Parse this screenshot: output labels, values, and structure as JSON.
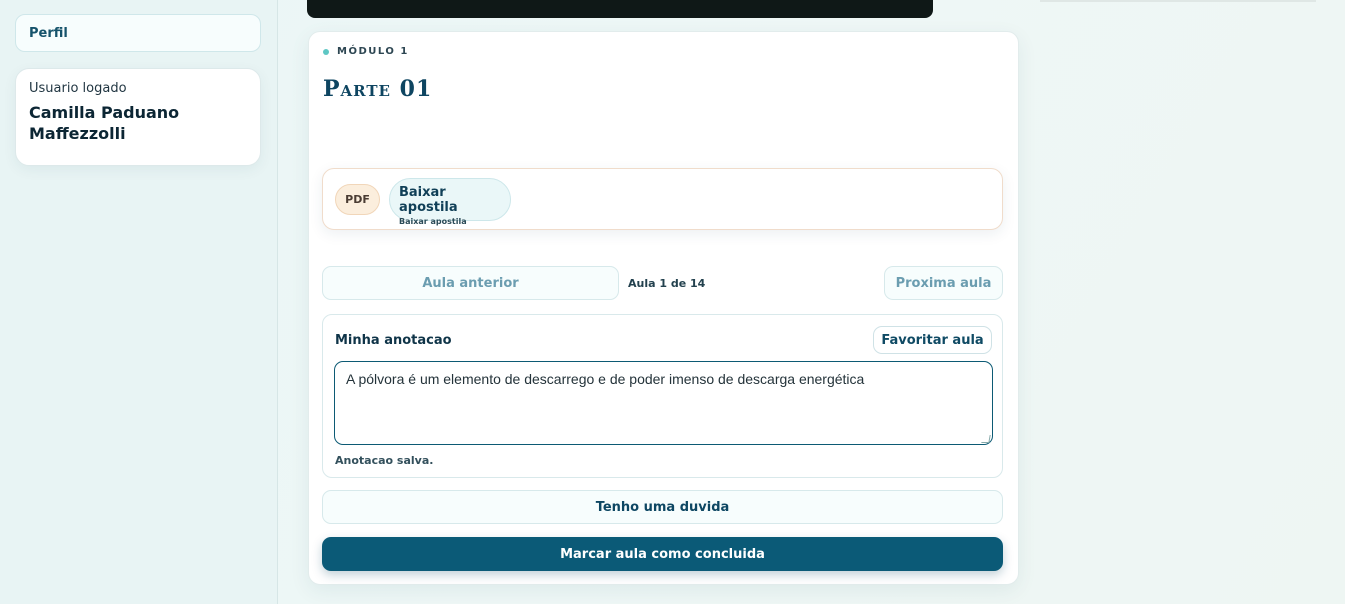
{
  "sidebar": {
    "nav_items": [
      {
        "label": "Perfil"
      }
    ],
    "user": {
      "label": "Usuario logado",
      "name": "Camilla Paduano Maffezzolli"
    }
  },
  "lesson": {
    "module": "MÓDULO 1",
    "title": "Parte 01",
    "attachment": {
      "badge": "PDF",
      "title": "Baixar apostila",
      "subtitle": "Baixar apostila"
    },
    "nav": {
      "prev_label": "Aula anterior",
      "counter": "Aula 1 de 14",
      "next_label": "Proxima aula"
    },
    "note": {
      "title": "Minha anotacao",
      "favorite_label": "Favoritar aula",
      "value": "A pólvora é um elemento de descarrego e de poder imenso de descarga energética",
      "status": "Anotacao salva."
    },
    "doubt_label": "Tenho uma duvida",
    "complete_label": "Marcar aula como concluida"
  },
  "colors": {
    "primary": "#0b5a77",
    "accent_dot": "#5ec7c4"
  }
}
